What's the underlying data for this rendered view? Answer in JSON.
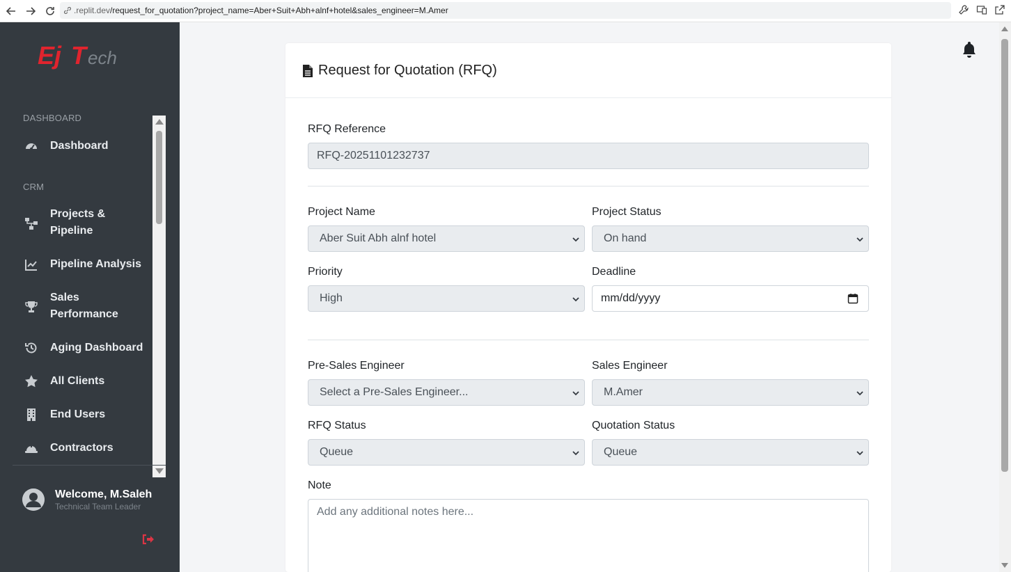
{
  "browser": {
    "url_host": ".replit.dev",
    "url_path": "/request_for_quotation?project_name=Aber+Suit+Abh+alnf+hotel&sales_engineer=M.Amer"
  },
  "sidebar": {
    "brand": "EJTech",
    "sections": [
      {
        "label": "DASHBOARD"
      },
      {
        "label": "CRM"
      }
    ],
    "items": [
      {
        "label": "Dashboard",
        "icon": "gauge-icon"
      },
      {
        "label": "Projects & Pipeline",
        "icon": "sitemap-icon"
      },
      {
        "label": "Pipeline Analysis",
        "icon": "chart-line-icon"
      },
      {
        "label": "Sales Performance",
        "icon": "trophy-icon"
      },
      {
        "label": "Aging Dashboard",
        "icon": "history-icon"
      },
      {
        "label": "All Clients",
        "icon": "star-icon"
      },
      {
        "label": "End Users",
        "icon": "building-icon"
      },
      {
        "label": "Contractors",
        "icon": "hard-hat-icon"
      }
    ],
    "user": {
      "welcome": "Welcome, M.Saleh",
      "role": "Technical Team Leader"
    }
  },
  "form": {
    "title": "Request for Quotation (RFQ)",
    "rfq_reference": {
      "label": "RFQ Reference",
      "value": "RFQ-20251101232737"
    },
    "project_name": {
      "label": "Project Name",
      "value": "Aber Suit Abh alnf hotel"
    },
    "project_status": {
      "label": "Project Status",
      "value": "On hand"
    },
    "priority": {
      "label": "Priority",
      "value": "High"
    },
    "deadline": {
      "label": "Deadline",
      "placeholder": "mm/dd/yyyy"
    },
    "pre_sales_engineer": {
      "label": "Pre-Sales Engineer",
      "value": "Select a Pre-Sales Engineer..."
    },
    "sales_engineer": {
      "label": "Sales Engineer",
      "value": "M.Amer"
    },
    "rfq_status": {
      "label": "RFQ Status",
      "value": "Queue"
    },
    "quotation_status": {
      "label": "Quotation Status",
      "value": "Queue"
    },
    "note": {
      "label": "Note",
      "placeholder": "Add any additional notes here..."
    }
  },
  "colors": {
    "sidebar_bg": "#343a40",
    "brand_red": "#e0242e",
    "logout_red": "#dc3545",
    "field_bg": "#e9ecef"
  }
}
